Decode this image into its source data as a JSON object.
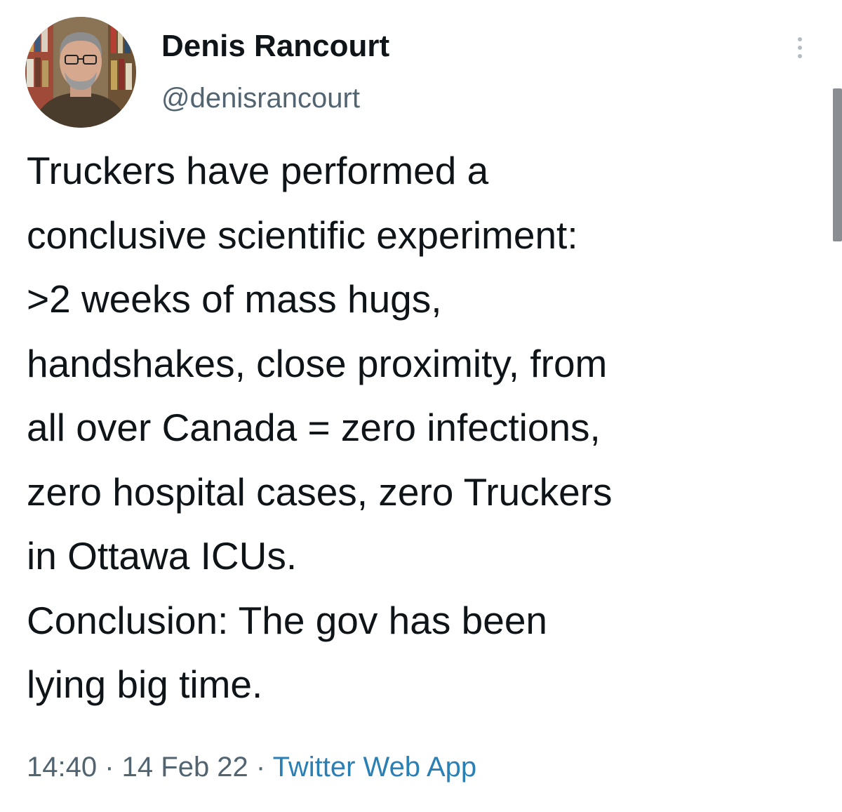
{
  "author": {
    "display_name": "Denis Rancourt",
    "handle": "@denisrancourt"
  },
  "tweet": {
    "lines": [
      "Truckers have performed a",
      "conclusive scientific experiment:",
      ">2 weeks of mass hugs,",
      "handshakes, close proximity, from",
      "all over Canada = zero infections,",
      "zero hospital cases, zero Truckers",
      "in Ottawa ICUs.",
      "Conclusion: The gov has been",
      "lying big time."
    ],
    "time": "14:40",
    "separator": " · ",
    "date": "14 Feb 22",
    "source": "Twitter Web App"
  },
  "icons": {
    "more": "more-vertical-icon"
  },
  "colors": {
    "text": "#0f1419",
    "secondary": "#536471",
    "link": "#2a7fb5"
  }
}
